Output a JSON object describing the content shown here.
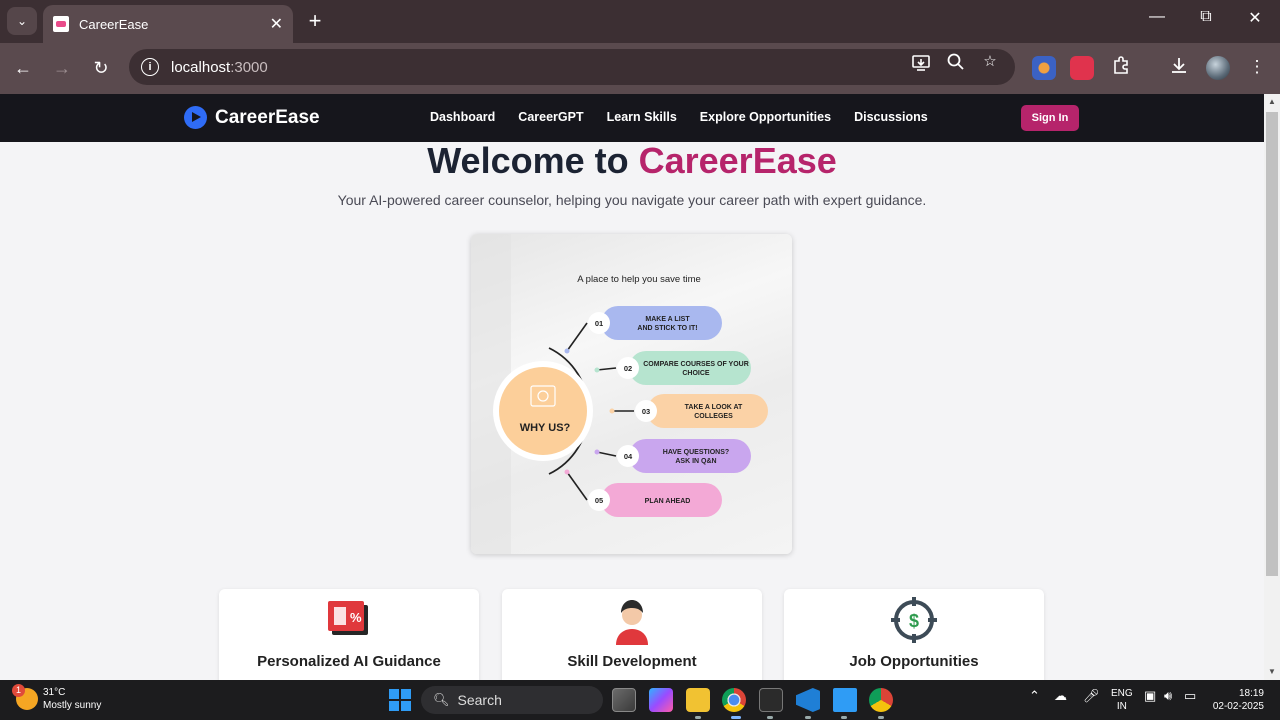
{
  "browser": {
    "tab_title": "CareerEase",
    "url_host": "localhost",
    "url_port": ":3000"
  },
  "site": {
    "brand": "CareerEase",
    "nav": [
      "Dashboard",
      "CareerGPT",
      "Learn Skills",
      "Explore Opportunities",
      "Discussions"
    ],
    "signin_label": "Sign In",
    "hero_title_prefix": "Welcome to ",
    "hero_title_accent": "CareerEase",
    "hero_subtitle": "Your AI-powered career counselor, helping you navigate your career path with expert guidance.",
    "accent_color": "#b6246b"
  },
  "infographic": {
    "heading": "A place to help you save time",
    "center_label": "WHY US?",
    "steps": [
      {
        "num": "01",
        "line1": "MAKE A LIST",
        "line2": "AND STICK TO IT!",
        "color": "#a9b8ef"
      },
      {
        "num": "02",
        "line1": "COMPARE  COURSES OF YOUR",
        "line2": "CHOICE",
        "color": "#b6e4cf"
      },
      {
        "num": "03",
        "line1": "TAKE A LOOK AT",
        "line2": "COLLEGES",
        "color": "#fbd2a6"
      },
      {
        "num": "04",
        "line1": "HAVE QUESTIONS?",
        "line2": "ASK IN Q&N",
        "color": "#c9a6ee"
      },
      {
        "num": "05",
        "line1": "PLAN AHEAD",
        "line2": "",
        "color": "#f3a9d6"
      }
    ]
  },
  "features": [
    {
      "title": "Personalized AI Guidance",
      "icon": "gift-percent-icon"
    },
    {
      "title": "Skill Development",
      "icon": "person-avatar-icon"
    },
    {
      "title": "Job Opportunities",
      "icon": "dollar-target-icon"
    }
  ],
  "taskbar": {
    "weather_temp": "31°C",
    "weather_desc": "Mostly sunny",
    "weather_badge": "1",
    "search_label": "Search",
    "lang_line1": "ENG",
    "lang_line2": "IN",
    "time": "18:19",
    "date": "02-02-2025"
  }
}
